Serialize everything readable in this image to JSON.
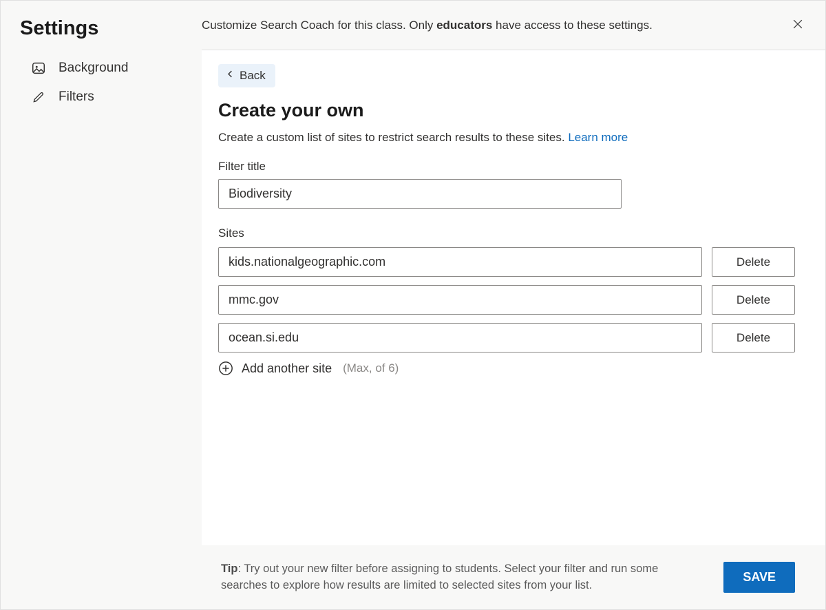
{
  "sidebar": {
    "title": "Settings",
    "items": [
      {
        "label": "Background"
      },
      {
        "label": "Filters"
      }
    ]
  },
  "header": {
    "text_prefix": "Customize Search Coach for this class. Only ",
    "text_bold": "educators",
    "text_suffix": " have access to these settings."
  },
  "main": {
    "back_label": "Back",
    "title": "Create your own",
    "description": "Create a custom list of sites to restrict search results to these sites. ",
    "learn_more_label": "Learn more",
    "filter_title_label": "Filter title",
    "filter_title_value": "Biodiversity",
    "sites_label": "Sites",
    "sites": [
      {
        "value": "kids.nationalgeographic.com"
      },
      {
        "value": "mmc.gov"
      },
      {
        "value": "ocean.si.edu"
      }
    ],
    "delete_label": "Delete",
    "add_another_label": "Add another site",
    "add_max_label": "(Max, of 6)"
  },
  "footer": {
    "tip_bold": "Tip",
    "tip_text": ": Try out your new filter before assigning to students. Select your filter and run some searches to explore how results are limited to selected sites from your list.",
    "save_label": "SAVE"
  }
}
